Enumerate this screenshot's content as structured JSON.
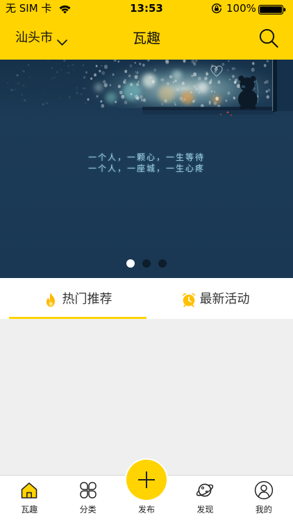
{
  "status_bar": {
    "carrier": "无 SIM 卡",
    "time": "13:53",
    "battery_text": "100%",
    "battery_level": 1.0
  },
  "header": {
    "city": "汕头市",
    "title": "瓦趣",
    "city_icon": "chevron-down-icon",
    "search_icon": "search-icon"
  },
  "banner": {
    "lines": [
      "一个人，一颗心，一生等待",
      "一个人，一座城，一生心疼"
    ]
  },
  "carousel": {
    "total": 3,
    "current": 1
  },
  "tabs": [
    {
      "label": "热门推荐",
      "icon": "flame-icon",
      "active": true
    },
    {
      "label": "最新活动",
      "icon": "alarm-clock-icon",
      "active": false
    }
  ],
  "bottom_nav": [
    {
      "label": "瓦趣",
      "icon": "home-icon",
      "active": true
    },
    {
      "label": "分类",
      "icon": "category-icon",
      "active": false
    },
    {
      "label": "发布",
      "icon": "plus-icon",
      "active": false
    },
    {
      "label": "发现",
      "icon": "planet-icon",
      "active": false
    },
    {
      "label": "我的",
      "icon": "user-icon",
      "active": false
    }
  ],
  "colors": {
    "brand": "#FFD400",
    "banner_bg": "#1b3a55",
    "text": "#333333",
    "content_bg": "#efefef"
  }
}
